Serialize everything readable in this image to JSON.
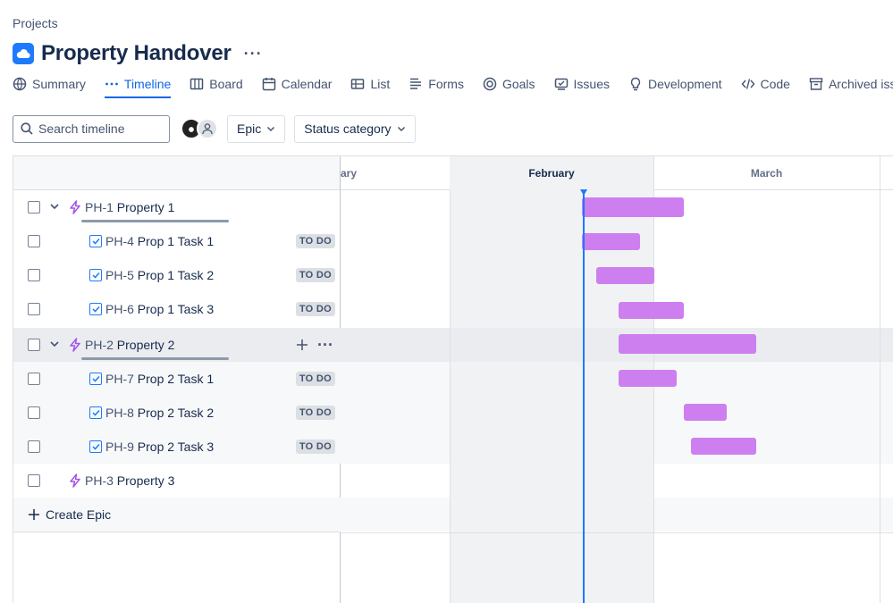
{
  "breadcrumb": "Projects",
  "project": {
    "title": "Property Handover",
    "more": "···"
  },
  "tabs": [
    {
      "label": "Summary",
      "icon": "globe-icon",
      "active": false
    },
    {
      "label": "Timeline",
      "icon": "timeline-dots-icon",
      "active": true
    },
    {
      "label": "Board",
      "icon": "board-icon",
      "active": false
    },
    {
      "label": "Calendar",
      "icon": "calendar-icon",
      "active": false
    },
    {
      "label": "List",
      "icon": "list-icon",
      "active": false
    },
    {
      "label": "Forms",
      "icon": "forms-icon",
      "active": false
    },
    {
      "label": "Goals",
      "icon": "goals-icon",
      "active": false
    },
    {
      "label": "Issues",
      "icon": "issues-icon",
      "active": false
    },
    {
      "label": "Development",
      "icon": "lightbulb-icon",
      "active": false
    },
    {
      "label": "Code",
      "icon": "code-icon",
      "active": false
    },
    {
      "label": "Archived iss",
      "icon": "archive-icon",
      "active": false
    }
  ],
  "toolbar": {
    "search_placeholder": "Search timeline",
    "filter_epic": "Epic",
    "filter_status": "Status category"
  },
  "timeline": {
    "months": [
      "ary",
      "February",
      "March"
    ],
    "current_month": "February"
  },
  "rows": [
    {
      "type": "epic",
      "key": "PH-1",
      "title": "Property 1",
      "expanded": true
    },
    {
      "type": "task",
      "key": "PH-4",
      "title": "Prop 1 Task 1",
      "status": "TO DO"
    },
    {
      "type": "task",
      "key": "PH-5",
      "title": "Prop 1 Task 2",
      "status": "TO DO"
    },
    {
      "type": "task",
      "key": "PH-6",
      "title": "Prop 1 Task 3",
      "status": "TO DO"
    },
    {
      "type": "epic",
      "key": "PH-2",
      "title": "Property 2",
      "expanded": true,
      "hovered": true
    },
    {
      "type": "task",
      "key": "PH-7",
      "title": "Prop 2 Task 1",
      "status": "TO DO"
    },
    {
      "type": "task",
      "key": "PH-8",
      "title": "Prop 2 Task 2",
      "status": "TO DO"
    },
    {
      "type": "task",
      "key": "PH-9",
      "title": "Prop 2 Task 3",
      "status": "TO DO"
    },
    {
      "type": "epic",
      "key": "PH-3",
      "title": "Property 3",
      "expanded": false
    }
  ],
  "create_epic": "Create Epic",
  "colors": {
    "accent": "#0c66e4",
    "bar": "#cd7ff0",
    "today": "#1d7afc"
  }
}
